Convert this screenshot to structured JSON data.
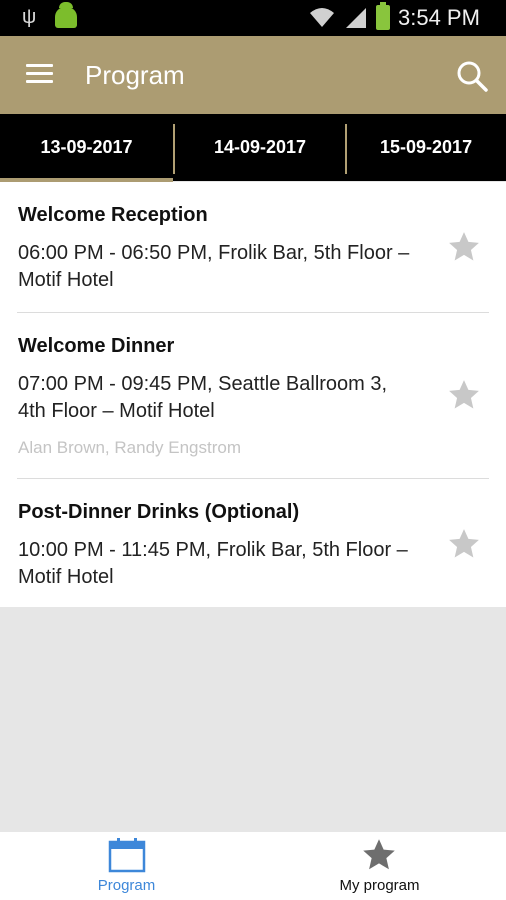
{
  "status_bar": {
    "time": "3:54 PM"
  },
  "app_bar": {
    "title": "Program"
  },
  "tabs": [
    {
      "label": "13-09-2017",
      "selected": true
    },
    {
      "label": "14-09-2017",
      "selected": false
    },
    {
      "label": "15-09-2017",
      "selected": false
    }
  ],
  "sessions": [
    {
      "title": "Welcome Reception",
      "details": "06:00 PM - 06:50 PM, Frolik Bar, 5th Floor – Motif Hotel",
      "speakers": "",
      "starred": false
    },
    {
      "title": "Welcome Dinner",
      "details": "07:00 PM - 09:45 PM, Seattle Ballroom 3, 4th Floor – Motif Hotel",
      "speakers": "Alan Brown, Randy Engstrom",
      "starred": false
    },
    {
      "title": "Post-Dinner Drinks (Optional)",
      "details": "10:00 PM - 11:45 PM, Frolik Bar, 5th Floor – Motif Hotel",
      "speakers": "",
      "starred": false
    }
  ],
  "bottom_nav": [
    {
      "label": "Program",
      "icon": "calendar-icon",
      "active": true
    },
    {
      "label": "My program",
      "icon": "star-icon",
      "active": false
    }
  ],
  "colors": {
    "accent": "#ac9c72",
    "active_nav": "#3d87d9",
    "star_inactive": "#c8c8c8"
  }
}
